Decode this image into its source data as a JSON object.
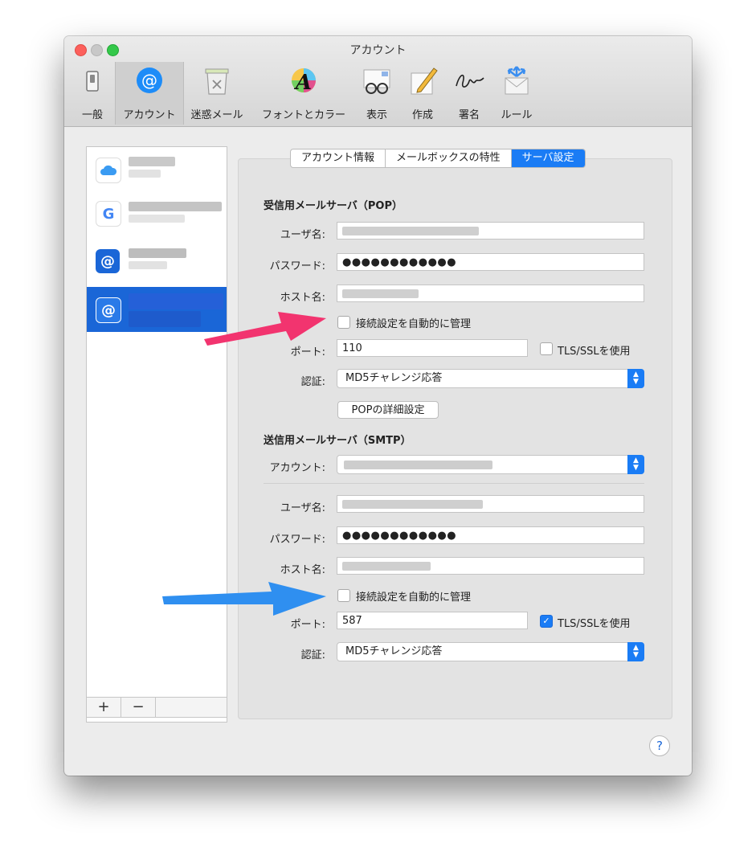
{
  "window": {
    "title": "アカウント"
  },
  "toolbar": {
    "items": [
      {
        "label": "一般",
        "icon": "switch-icon"
      },
      {
        "label": "アカウント",
        "icon": "at-sign-icon",
        "active": true
      },
      {
        "label": "迷惑メール",
        "icon": "trash-icon"
      },
      {
        "label": "フォントとカラー",
        "icon": "font-icon"
      },
      {
        "label": "表示",
        "icon": "glasses-icon"
      },
      {
        "label": "作成",
        "icon": "pencil-icon"
      },
      {
        "label": "署名",
        "icon": "signature-icon"
      },
      {
        "label": "ルール",
        "icon": "rules-icon"
      }
    ]
  },
  "accounts": {
    "items": [
      {
        "icon": "icloud-icon"
      },
      {
        "icon": "google-icon",
        "glyph": "G"
      },
      {
        "icon": "at-sign-icon",
        "glyph": "@"
      },
      {
        "icon": "at-sign-icon",
        "glyph": "@",
        "selected": true
      }
    ],
    "add_label": "+",
    "remove_label": "−"
  },
  "tabs": [
    {
      "label": "アカウント情報"
    },
    {
      "label": "メールボックスの特性"
    },
    {
      "label": "サーバ設定",
      "active": true
    }
  ],
  "incoming": {
    "heading": "受信用メールサーバ（POP）",
    "username_label": "ユーザ名:",
    "password_label": "パスワード:",
    "password_value": "●●●●●●●●●●●●",
    "host_label": "ホスト名:",
    "auto_manage_label": "接続設定を自動的に管理",
    "auto_manage_checked": false,
    "port_label": "ポート:",
    "port_value": "110",
    "tls_label": "TLS/SSLを使用",
    "tls_checked": false,
    "auth_label": "認証:",
    "auth_value": "MD5チャレンジ応答",
    "advanced_button": "POPの詳細設定"
  },
  "outgoing": {
    "heading": "送信用メールサーバ（SMTP）",
    "account_label": "アカウント:",
    "username_label": "ユーザ名:",
    "password_label": "パスワード:",
    "password_value": "●●●●●●●●●●●●",
    "host_label": "ホスト名:",
    "auto_manage_label": "接続設定を自動的に管理",
    "auto_manage_checked": false,
    "port_label": "ポート:",
    "port_value": "587",
    "tls_label": "TLS/SSLを使用",
    "tls_checked": true,
    "auth_label": "認証:",
    "auth_value": "MD5チャレンジ応答"
  },
  "help": {
    "label": "?"
  },
  "colors": {
    "accent": "#1a7cf5",
    "selection": "#1a66d7",
    "pink_arrow": "#f2346f",
    "blue_arrow": "#2f8ff0"
  }
}
